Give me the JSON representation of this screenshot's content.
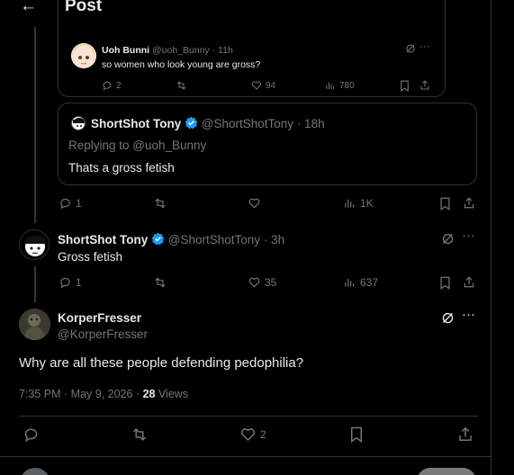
{
  "header": {
    "title": "Post"
  },
  "quote_inner": {
    "name": "Uoh Bunni",
    "handle": "@uoh_Bunny",
    "time": "· 11h",
    "text": "so women who look young are gross?",
    "replies": "2",
    "likes": "94",
    "views": "780"
  },
  "reply1": {
    "name": "ShortShot Tony",
    "handle": "@ShortShotTony",
    "time": "· 18h",
    "replying_to": "Replying to @uoh_Bunny",
    "text": "Thats a gross fetish",
    "replies": "1",
    "views": "1K"
  },
  "reply2": {
    "name": "ShortShot Tony",
    "handle": "@ShortShotTony",
    "time": "· 3h",
    "text": "Gross fetish",
    "replies": "1",
    "likes": "35",
    "views": "637"
  },
  "main": {
    "name": "KorperFresser",
    "handle": "@KorperFresser",
    "text": "Why are all these people defending pedophilia?",
    "timestamp": "7:35 PM · May 9, 2026 · ",
    "views_count": "28",
    "views_label": " Views",
    "likes": "2"
  },
  "colors": {
    "bg": "#000000",
    "text": "#e7e9ea",
    "muted": "#71767b",
    "border": "#2f3336",
    "verified": "#1d9bf0"
  }
}
